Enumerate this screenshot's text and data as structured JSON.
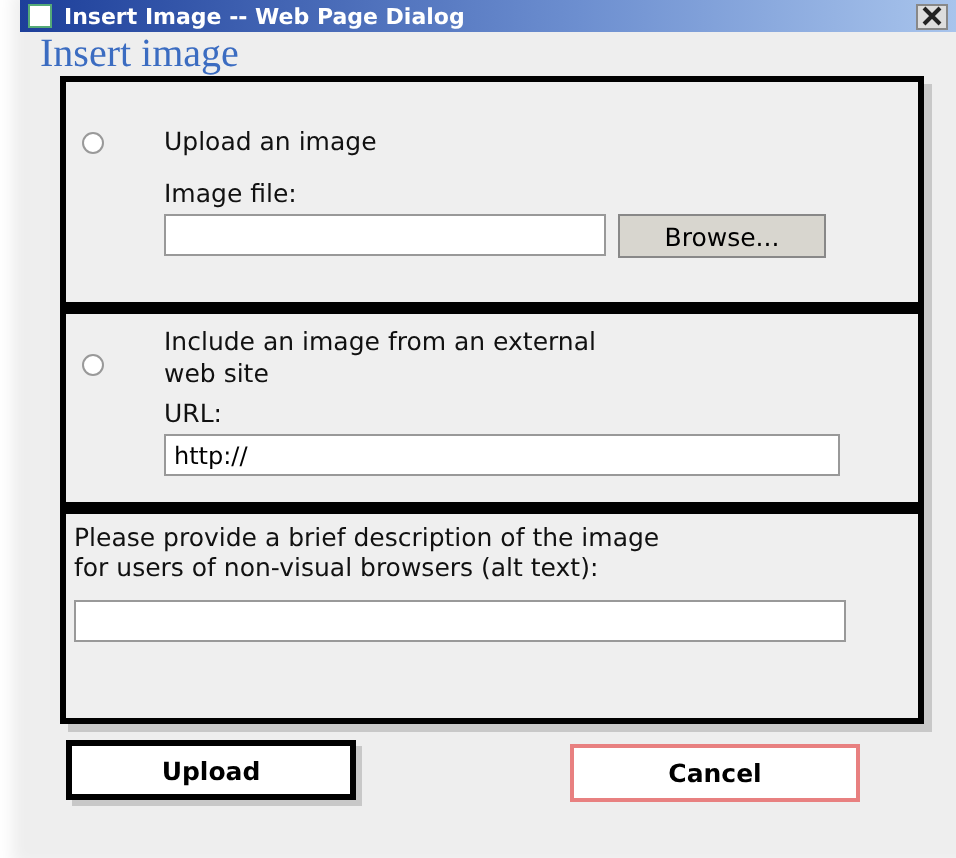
{
  "window": {
    "title": "Insert Image -- Web Page Dialog"
  },
  "heading": "Insert image",
  "sections": [
    {
      "kind": "upload",
      "option": {
        "label": "Upload an image",
        "selected": false
      },
      "field_label": "Image file:",
      "button": "Browse..."
    },
    {
      "kind": "url",
      "option": {
        "label": "Include an image from an external web site",
        "selected": false
      },
      "field_label": "URL:",
      "value": "http://"
    },
    {
      "kind": "alt",
      "field_label": "Please provide a brief description of the image for users of non-visual browsers (alt text):"
    }
  ],
  "buttons": [
    {
      "label": "Upload",
      "kind": "primary"
    },
    {
      "label": "Cancel",
      "kind": "cancel"
    }
  ]
}
